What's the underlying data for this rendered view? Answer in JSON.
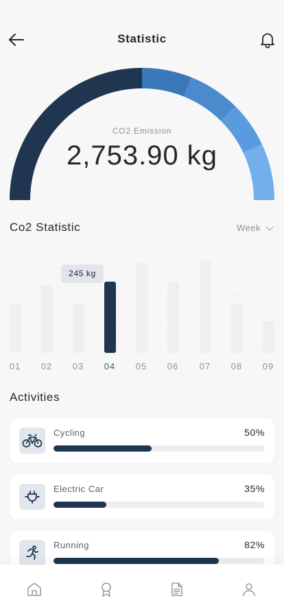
{
  "header": {
    "title": "Statistic",
    "back_icon": "arrow-left-icon",
    "bell_icon": "bell-icon"
  },
  "gauge": {
    "label": "CO2 Emission",
    "value": "2,753.90 kg",
    "segment_colors": [
      "#1f3550",
      "#3a78b8",
      "#4b8bcd",
      "#5a9be0",
      "#73afeb"
    ]
  },
  "statistic": {
    "title": "Co2 Statistic",
    "period": "Week",
    "period_icon": "chevron-down-icon",
    "tooltip": "245 kg",
    "bars": [
      {
        "label": "01",
        "value": 0.53,
        "active": false
      },
      {
        "label": "02",
        "value": 0.73,
        "active": false
      },
      {
        "label": "03",
        "value": 0.53,
        "active": false
      },
      {
        "label": "04",
        "value": 0.77,
        "active": true
      },
      {
        "label": "05",
        "value": 0.98,
        "active": false
      },
      {
        "label": "06",
        "value": 0.77,
        "active": false
      },
      {
        "label": "07",
        "value": 1.0,
        "active": false
      },
      {
        "label": "08",
        "value": 0.53,
        "active": false
      },
      {
        "label": "09",
        "value": 0.34,
        "active": false
      }
    ]
  },
  "activities": {
    "title": "Activities",
    "items": [
      {
        "name": "Cycling",
        "percent": "50%",
        "progress": 0.465,
        "icon": "bicycle-icon"
      },
      {
        "name": "Electric Car",
        "percent": "35%",
        "progress": 0.25,
        "icon": "plug-icon"
      },
      {
        "name": "Running",
        "percent": "82%",
        "progress": 0.784,
        "icon": "running-icon"
      }
    ]
  },
  "tabbar": {
    "items": [
      "home-icon",
      "award-icon",
      "document-icon",
      "user-icon"
    ]
  },
  "colors": {
    "accent_dark": "#1f3550",
    "active_label": "#2c6b54",
    "background": "#f7f7f7"
  }
}
